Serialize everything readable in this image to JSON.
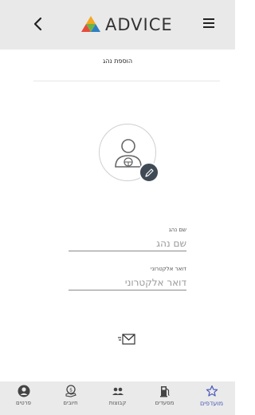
{
  "header": {
    "brand": "ADVICE",
    "back_icon": "chevron-left-icon",
    "menu_icon": "hamburger-menu-icon"
  },
  "page": {
    "title": "הוספת נהג"
  },
  "avatar": {
    "icon": "driver-avatar-icon",
    "edit_icon": "pencil-icon"
  },
  "form": {
    "driver_name": {
      "label": "שם נהג",
      "placeholder": "שם נהג",
      "value": ""
    },
    "email": {
      "label": "דואר אלקטרוני",
      "placeholder": "דואר אלקטרוני",
      "value": ""
    }
  },
  "send_icon": "send-mail-icon",
  "bottom_nav": {
    "items": [
      {
        "label": "פרטים",
        "icon": "person-icon"
      },
      {
        "label": "חיובים",
        "icon": "billing-icon"
      },
      {
        "label": "קבוצות",
        "icon": "groups-icon"
      },
      {
        "label": "מסעדים",
        "icon": "fuel-pump-icon"
      },
      {
        "label": "מועדפים",
        "icon": "star-icon"
      }
    ]
  },
  "colors": {
    "header_bg": "#e9e9e9",
    "accent": "#4a5ab8",
    "edit_button": "#3f4a55",
    "logo_orange": "#f5a623",
    "logo_red": "#e84b3c",
    "logo_blue": "#2d7fc1",
    "logo_green": "#6bb544"
  }
}
